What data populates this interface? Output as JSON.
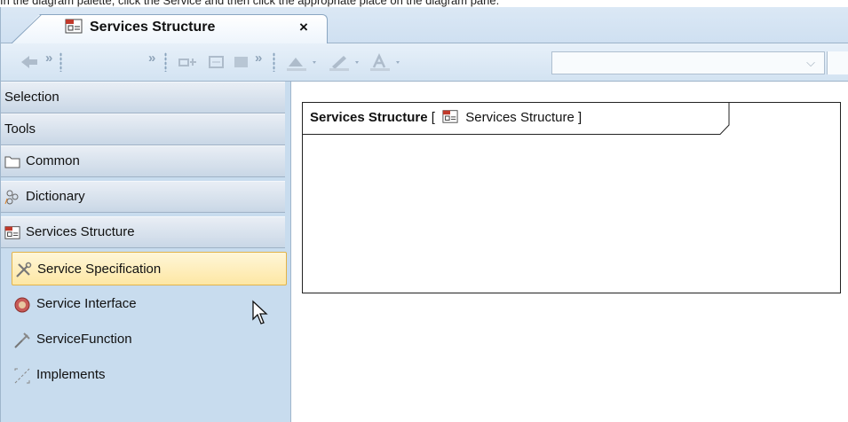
{
  "caption": "In the diagram palette, click the Service and then click the appropriate place on the diagram pane.",
  "tab": {
    "title": "Services Structure",
    "close_label": "×",
    "icon": "services-structure-icon"
  },
  "toolbar": {
    "overflow_label": "»",
    "combo_value": "",
    "combo_arrow": "⌵"
  },
  "palette": {
    "sections": [
      {
        "label": "Selection"
      },
      {
        "label": "Tools"
      },
      {
        "label": "Common",
        "icon": "folder-icon"
      },
      {
        "label": "Dictionary",
        "icon": "dictionary-icon"
      },
      {
        "label": "Services Structure",
        "icon": "services-structure-icon"
      }
    ],
    "items": [
      {
        "label": "Service Specification",
        "icon": "service-specification-icon",
        "selected": true
      },
      {
        "label": "Service Interface",
        "icon": "service-interface-icon"
      },
      {
        "label": "ServiceFunction",
        "icon": "service-function-icon"
      },
      {
        "label": "Implements",
        "icon": "implements-icon"
      }
    ]
  },
  "diagram": {
    "frame_name": "Services Structure",
    "frame_open": "[",
    "frame_type": "Services Structure",
    "frame_close": "]"
  },
  "colors": {
    "background": "#c8dcee",
    "selected_item": "#fde7a4",
    "pane": "#ffffff"
  }
}
